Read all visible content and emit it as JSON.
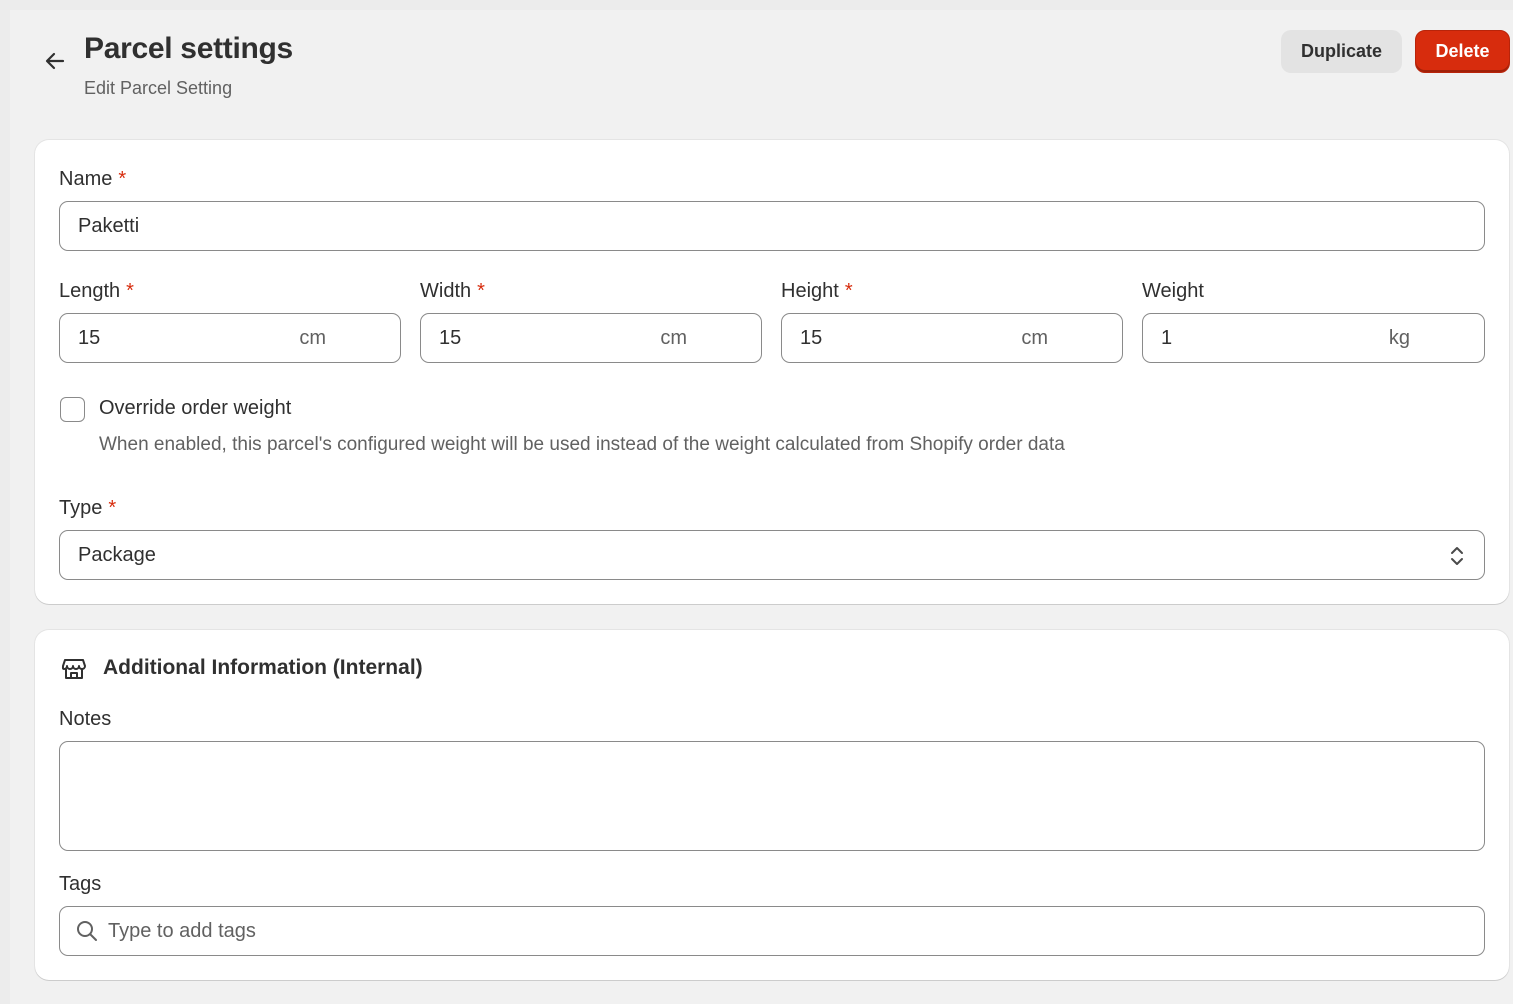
{
  "header": {
    "title": "Parcel settings",
    "subtitle": "Edit Parcel Setting",
    "duplicate_label": "Duplicate",
    "delete_label": "Delete"
  },
  "form": {
    "required_mark": "*",
    "name": {
      "label": "Name",
      "value": "Paketti"
    },
    "length": {
      "label": "Length",
      "value": "15",
      "unit": "cm"
    },
    "width": {
      "label": "Width",
      "value": "15",
      "unit": "cm"
    },
    "height": {
      "label": "Height",
      "value": "15",
      "unit": "cm"
    },
    "weight": {
      "label": "Weight",
      "value": "1",
      "unit": "kg"
    },
    "override": {
      "label": "Override order weight",
      "help": "When enabled, this parcel's configured weight will be used instead of the weight calculated from Shopify order data",
      "checked": false
    },
    "type": {
      "label": "Type",
      "value": "Package"
    }
  },
  "additional": {
    "title": "Additional Information (Internal)",
    "notes_label": "Notes",
    "notes_value": "",
    "tags_label": "Tags",
    "tags_placeholder": "Type to add tags"
  },
  "colors": {
    "critical": "#d72c0d",
    "surface": "#ffffff",
    "background": "#f1f1f1",
    "border": "#8a8a8a"
  },
  "icons": [
    "arrow-left-icon",
    "chevron-up-down-icon",
    "store-icon",
    "search-icon"
  ]
}
